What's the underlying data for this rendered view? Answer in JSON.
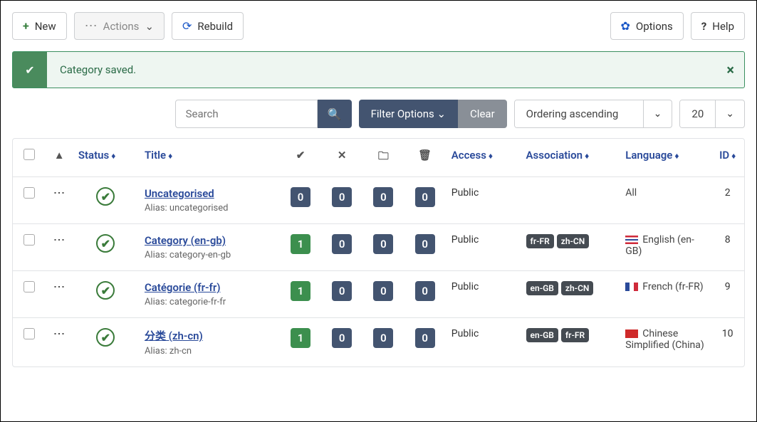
{
  "toolbar": {
    "new_label": "New",
    "actions_label": "Actions",
    "rebuild_label": "Rebuild",
    "options_label": "Options",
    "help_label": "Help"
  },
  "alert": {
    "message": "Category saved."
  },
  "filters": {
    "search_placeholder": "Search",
    "filter_options_label": "Filter Options",
    "clear_label": "Clear",
    "ordering_label": "Ordering ascending",
    "limit_label": "20"
  },
  "columns": {
    "status": "Status",
    "title": "Title",
    "access": "Access",
    "association": "Association",
    "language": "Language",
    "id": "ID"
  },
  "rows": [
    {
      "title": "Uncategorised",
      "alias": "Alias: uncategorised",
      "published": "0",
      "unpublished": "0",
      "archived": "0",
      "trashed": "0",
      "access": "Public",
      "associations": [],
      "language": "All",
      "flag": "none",
      "id": "2"
    },
    {
      "title": "Category (en-gb)",
      "alias": "Alias: category-en-gb",
      "published": "1",
      "unpublished": "0",
      "archived": "0",
      "trashed": "0",
      "access": "Public",
      "associations": [
        "fr-FR",
        "zh-CN"
      ],
      "language": "English (en-GB)",
      "flag": "gb",
      "id": "8"
    },
    {
      "title": "Catégorie (fr-fr)",
      "alias": "Alias: categorie-fr-fr",
      "published": "1",
      "unpublished": "0",
      "archived": "0",
      "trashed": "0",
      "access": "Public",
      "associations": [
        "en-GB",
        "zh-CN"
      ],
      "language": "French (fr-FR)",
      "flag": "fr",
      "id": "9"
    },
    {
      "title": "分类 (zh-cn)",
      "alias": "Alias: zh-cn",
      "published": "1",
      "unpublished": "0",
      "archived": "0",
      "trashed": "0",
      "access": "Public",
      "associations": [
        "en-GB",
        "fr-FR"
      ],
      "language": "Chinese Simplified (China)",
      "flag": "cn",
      "id": "10"
    }
  ]
}
